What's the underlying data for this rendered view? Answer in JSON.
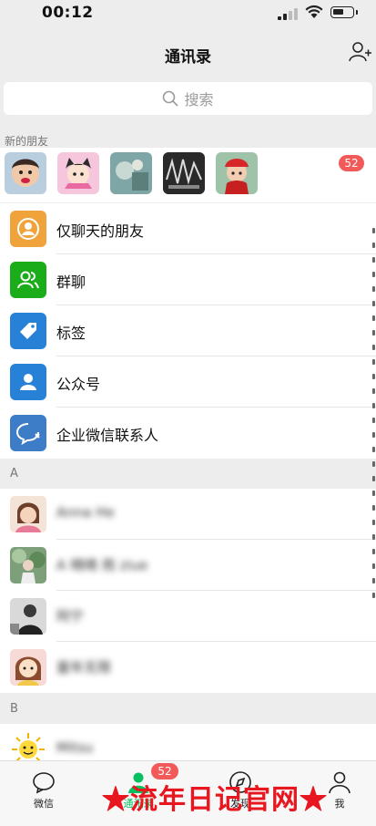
{
  "status_bar": {
    "time": "00:12"
  },
  "navbar": {
    "title": "通讯录"
  },
  "search": {
    "placeholder": "搜索"
  },
  "new_friends": {
    "label": "新的朋友",
    "badge": "52"
  },
  "functions": [
    {
      "label": "仅聊天的朋友",
      "icon": "person-chat-icon",
      "color": "#f0a23b"
    },
    {
      "label": "群聊",
      "icon": "group-chat-icon",
      "color": "#1aad19"
    },
    {
      "label": "标签",
      "icon": "tag-icon",
      "color": "#2782d7"
    },
    {
      "label": "公众号",
      "icon": "official-account-icon",
      "color": "#2782d7"
    },
    {
      "label": "企业微信联系人",
      "icon": "wecom-icon",
      "color": "#3d7dc7"
    }
  ],
  "sections": [
    {
      "letter": "A",
      "contacts": [
        "Anna He",
        "A 晴晴 雨 ziue",
        "阿宁",
        "童年无限"
      ]
    },
    {
      "letter": "B",
      "contacts": [
        "Mitsu"
      ]
    }
  ],
  "tabbar": {
    "tabs": [
      {
        "label": "微信",
        "icon": "chat-bubble-icon"
      },
      {
        "label": "通讯录",
        "icon": "contacts-icon"
      },
      {
        "label": "发现",
        "icon": "compass-icon"
      },
      {
        "label": "我",
        "icon": "me-icon"
      }
    ],
    "contacts_badge": "52"
  },
  "watermark": "★流年日记官网★",
  "colors": {
    "badge": "#f25a5a",
    "accent_green": "#07c160",
    "background": "#ededed"
  }
}
